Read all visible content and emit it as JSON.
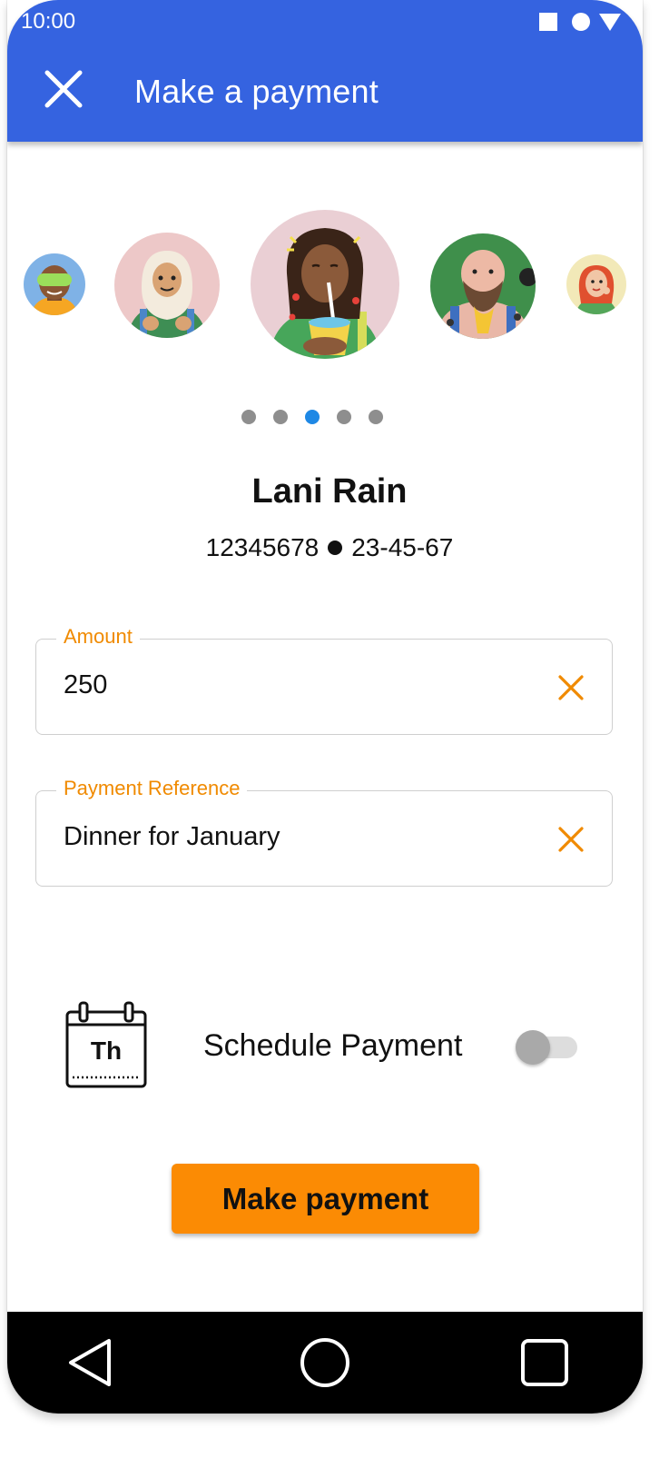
{
  "status_bar": {
    "time": "10:00"
  },
  "app_bar": {
    "title": "Make a payment",
    "icon": "close-icon"
  },
  "carousel": {
    "avatars": [
      {
        "icon": "avatar-vr-headset",
        "selected": false
      },
      {
        "icon": "avatar-hijab",
        "selected": false
      },
      {
        "icon": "avatar-dreadlocks-drink",
        "selected": true
      },
      {
        "icon": "avatar-bearded-tattoo",
        "selected": false
      },
      {
        "icon": "avatar-red-hair",
        "selected": false
      }
    ],
    "dots_count": 5,
    "active_dot": 2
  },
  "recipient": {
    "name": "Lani Rain",
    "account_number": "12345678",
    "sort_code": "23-45-67"
  },
  "amount_field": {
    "label": "Amount",
    "value": "250",
    "clear_icon": "clear-icon"
  },
  "reference_field": {
    "label": "Payment Reference",
    "value": "Dinner for January",
    "clear_icon": "clear-icon"
  },
  "schedule": {
    "icon": "calendar-icon",
    "day_abbr": "Th",
    "label": "Schedule Payment",
    "enabled": false
  },
  "primary_button": {
    "label": "Make payment"
  },
  "nav_bar": {
    "icons": [
      "back-icon",
      "home-icon",
      "recents-icon"
    ]
  },
  "colors": {
    "app_bar": "#3563E0",
    "accent": "#FB8B04",
    "label_orange": "#F08A00",
    "active_dot": "#1E88E5",
    "inactive_dot": "#8E8E8E"
  }
}
